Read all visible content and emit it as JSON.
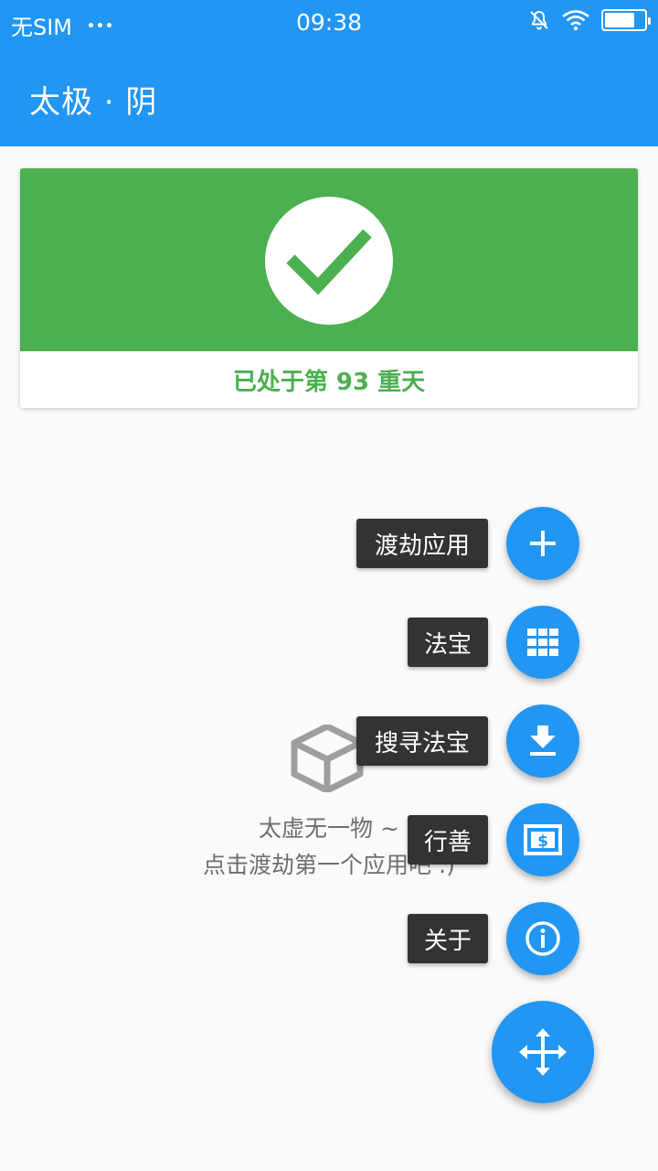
{
  "status_bar": {
    "carrier": "无SIM",
    "time": "09:38",
    "icons": [
      "more-dots-icon",
      "bell-off-icon",
      "wifi-icon",
      "battery-icon"
    ]
  },
  "app_bar": {
    "title": "太极 · 阴"
  },
  "status_card": {
    "icon": "check-circle-icon",
    "text": "已处于第 93 重天"
  },
  "empty_state": {
    "icon": "empty-box-icon",
    "line1": "太虚无一物 ~",
    "line2": "点击渡劫第一个应用吧 :)"
  },
  "fab_menu": {
    "items": [
      {
        "label": "渡劫应用",
        "icon": "plus-icon"
      },
      {
        "label": "法宝",
        "icon": "grid-icon"
      },
      {
        "label": "搜寻法宝",
        "icon": "download-icon"
      },
      {
        "label": "行善",
        "icon": "donate-icon"
      },
      {
        "label": "关于",
        "icon": "info-icon"
      }
    ],
    "main_icon": "move-arrows-icon"
  },
  "colors": {
    "primary": "#2196f3",
    "success": "#4caf50",
    "label_bg": "#333333",
    "background": "#fafafa"
  }
}
